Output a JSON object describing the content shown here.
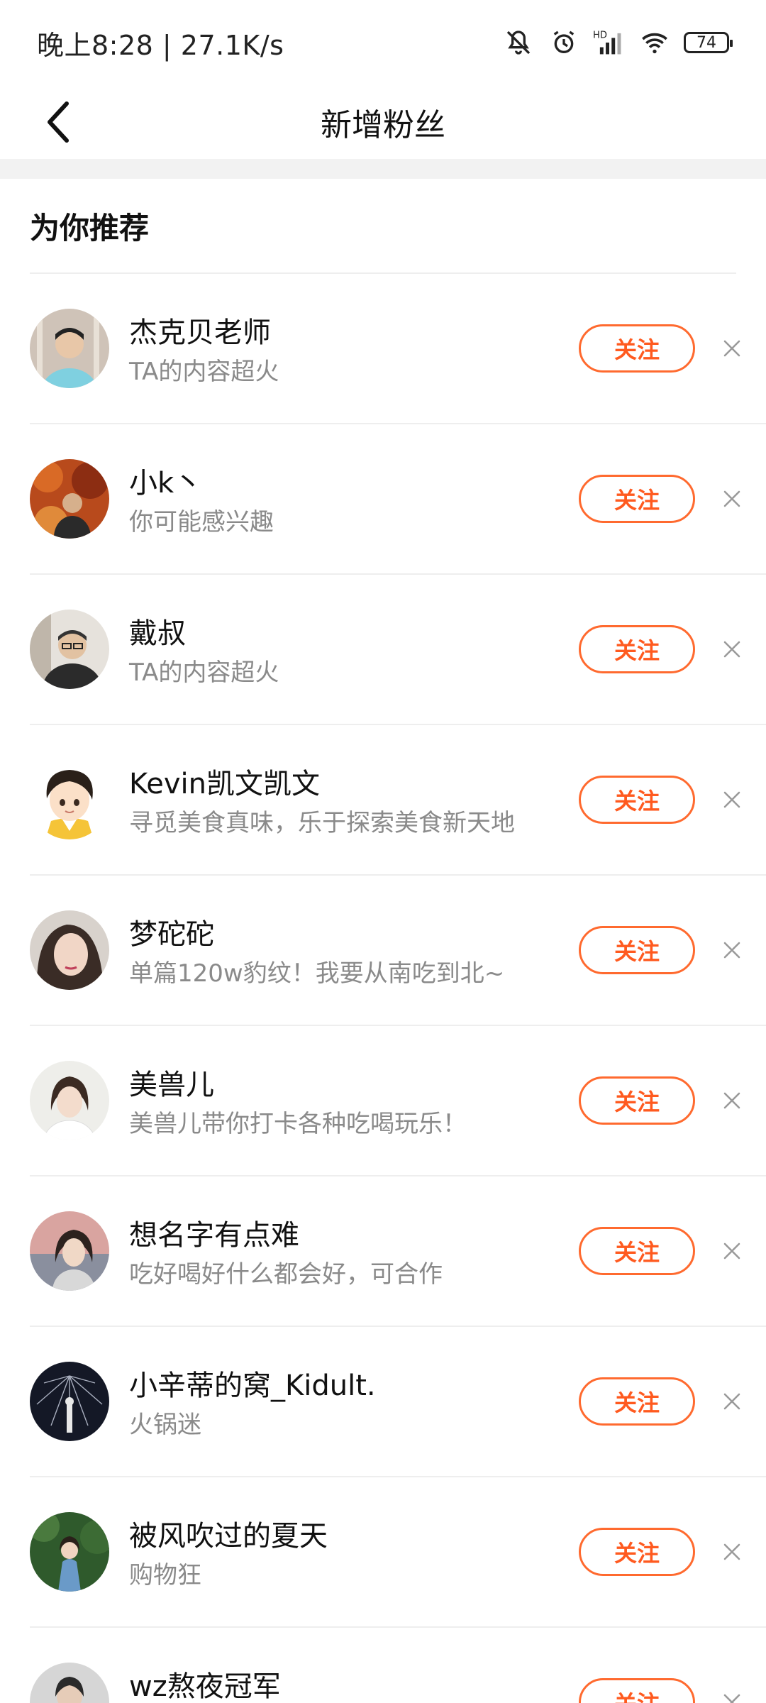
{
  "status_bar": {
    "time_speed": "晚上8:28 | 27.1K/s",
    "battery_level": "74",
    "icons": [
      "mute-bell-icon",
      "alarm-icon",
      "hd-signal-icon",
      "wifi-icon",
      "battery-icon"
    ]
  },
  "header": {
    "title": "新增粉丝",
    "back_icon": "chevron-left-icon"
  },
  "section": {
    "title": "为你推荐"
  },
  "colors": {
    "accent": "#ff5a1f",
    "subtitle": "#8a8a8a",
    "divider": "#eeeeee"
  },
  "recommendations": [
    {
      "name": "杰克贝老师",
      "subtitle": "TA的内容超火",
      "follow_label": "关注"
    },
    {
      "name": "小k丶",
      "subtitle": "你可能感兴趣",
      "follow_label": "关注"
    },
    {
      "name": "戴叔",
      "subtitle": "TA的内容超火",
      "follow_label": "关注"
    },
    {
      "name": "Kevin凯文凯文",
      "subtitle": "寻觅美食真味，乐于探索美食新天地",
      "follow_label": "关注"
    },
    {
      "name": "梦砣砣",
      "subtitle": "单篇120w豹纹！我要从南吃到北~",
      "follow_label": "关注"
    },
    {
      "name": "美兽儿",
      "subtitle": "美兽儿带你打卡各种吃喝玩乐！",
      "follow_label": "关注"
    },
    {
      "name": "想名字有点难",
      "subtitle": "吃好喝好什么都会好，可合作",
      "follow_label": "关注"
    },
    {
      "name": "小辛蒂的窝_Kidult.",
      "subtitle": "火锅迷",
      "follow_label": "关注"
    },
    {
      "name": "被风吹过的夏天",
      "subtitle": "购物狂",
      "follow_label": "关注"
    },
    {
      "name": "wz熬夜冠军",
      "subtitle": "",
      "follow_label": "关注"
    }
  ]
}
